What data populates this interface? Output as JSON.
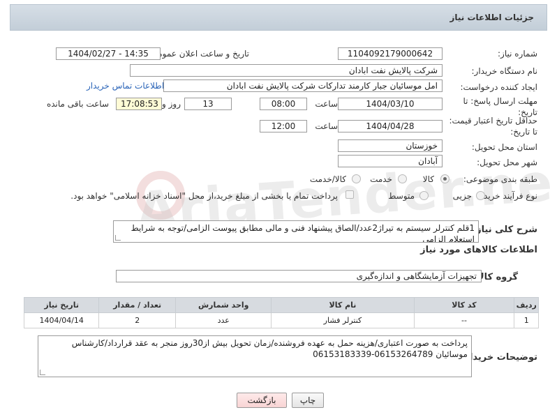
{
  "header": {
    "title": "جزئیات اطلاعات نیاز"
  },
  "fields": {
    "need_number_label": "شماره نیاز:",
    "need_number": "1104092179000642",
    "announce_label": "تاریخ و ساعت اعلان عمومی:",
    "announce_value": "1404/02/27 - 14:35",
    "buyer_org_label": "نام دستگاه خریدار:",
    "buyer_org": "شرکت پالایش نفت ابادان",
    "creator_label": "ایجاد کننده درخواست:",
    "creator": "امل موسائیان جبار کارمند تدارکات شرکت پالایش نفت ابادان",
    "contact_link": "اطلاعات تماس خریدار",
    "deadline_label": "مهلت ارسال پاسخ: تا تاریخ:",
    "deadline_date": "1404/03/10",
    "time_label": "ساعت",
    "deadline_time": "08:00",
    "days": "13",
    "days_label": "روز و",
    "remaining": "17:08:53",
    "remaining_label": "ساعت باقی مانده",
    "validity_label": "حداقل تاریخ اعتبار قیمت: تا تاریخ:",
    "validity_date": "1404/04/28",
    "validity_time": "12:00",
    "province_label": "استان محل تحویل:",
    "province": "خوزستان",
    "city_label": "شهر محل تحویل:",
    "city": "آبادان",
    "category_label": "طبقه بندی موضوعی:",
    "cat_goods": "کالا",
    "cat_service": "خدمت",
    "cat_goods_service": "کالا/خدمت",
    "process_label": "نوع فرآیند خرید :",
    "proc_partial": "جزیی",
    "proc_medium": "متوسط",
    "payment_note": "پرداخت تمام یا بخشی از مبلغ خرید،از محل \"اسناد خزانه اسلامی\" خواهد بود.",
    "description_label": "شرح کلی نیاز:",
    "description": "1قلم کنترلر سیستم به تیراژ2عدد/الصاق پیشنهاد فنی و مالی مطابق پیوست الزامی/توجه به شرایط استعلام الزامی",
    "goods_info_title": "اطلاعات کالاهای مورد نیاز",
    "goods_group_label": "گروه کالا:",
    "goods_group": "تجهیزات آزمایشگاهی و اندازه‌گیری",
    "buyer_notes_label": "توضیحات خریدار:",
    "buyer_notes": "پرداخت به صورت اعتباری/هزینه حمل به عهده فروشنده/زمان تحویل بیش از30روز منجر به عقد قرارداد/کارشناس موسائیان 06153264789-06153183339"
  },
  "table": {
    "headers": [
      "ردیف",
      "کد کالا",
      "نام کالا",
      "واحد شمارش",
      "تعداد / مقدار",
      "تاریخ نیاز"
    ],
    "rows": [
      [
        "1",
        "--",
        "کنترلر فشار",
        "عدد",
        "2",
        "1404/04/14"
      ]
    ]
  },
  "buttons": {
    "print": "چاپ",
    "back": "بازگشت"
  },
  "watermark": "AriaTender.neT"
}
